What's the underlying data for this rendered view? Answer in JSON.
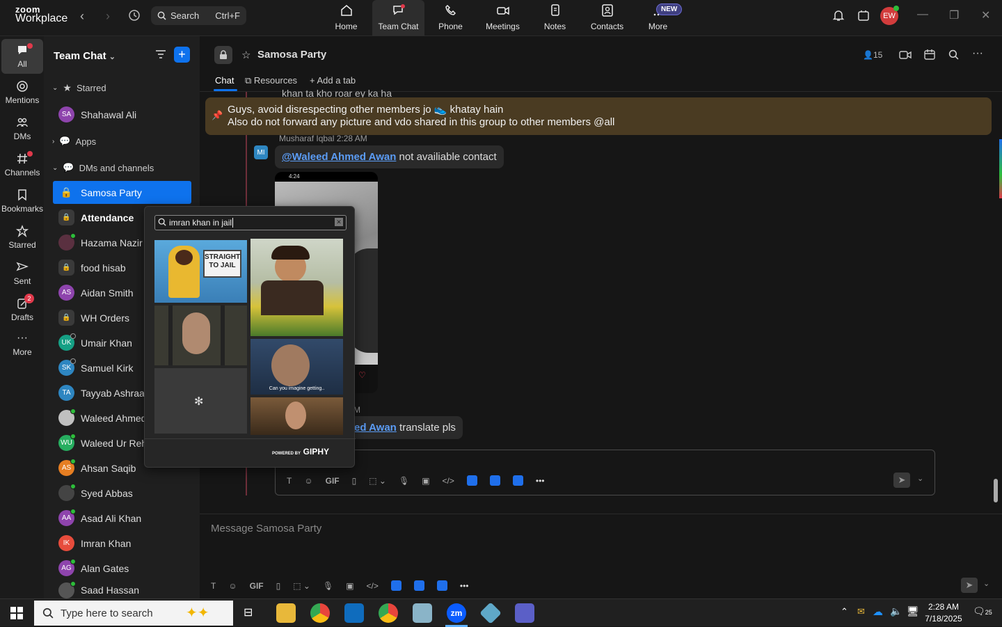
{
  "app": {
    "logo_line1": "zoom",
    "logo_line2": "Workplace"
  },
  "search": {
    "label": "Search",
    "shortcut": "Ctrl+F"
  },
  "topnav": [
    {
      "label": "Home",
      "icon": "home-icon"
    },
    {
      "label": "Team Chat",
      "icon": "chat-icon",
      "active": true
    },
    {
      "label": "Phone",
      "icon": "phone-icon"
    },
    {
      "label": "Meetings",
      "icon": "camera-icon"
    },
    {
      "label": "Notes",
      "icon": "notes-icon"
    },
    {
      "label": "Contacts",
      "icon": "contacts-icon"
    },
    {
      "label": "More",
      "icon": "more-icon"
    }
  ],
  "new_badge": "NEW",
  "user_initials": "EW",
  "rail": [
    {
      "label": "All"
    },
    {
      "label": "Mentions"
    },
    {
      "label": "DMs"
    },
    {
      "label": "Channels"
    },
    {
      "label": "Bookmarks"
    },
    {
      "label": "Starred"
    },
    {
      "label": "Sent"
    },
    {
      "label": "Drafts",
      "badge": "2"
    },
    {
      "label": "More"
    }
  ],
  "sidebar": {
    "title": "Team Chat",
    "starred_label": "Starred",
    "apps_label": "Apps",
    "dms_label": "DMs and channels",
    "starred_item": "Shahawal Ali",
    "items": [
      "Samosa Party",
      "Attendance",
      "Hazama Nazir",
      "food hisab",
      "Aidan Smith",
      "WH Orders",
      "Umair Khan",
      "Samuel Kirk",
      "Tayyab Ashraaf",
      "Waleed Ahmed",
      "Waleed Ur Rehm",
      "Ahsan Saqib",
      "Syed Abbas",
      "Asad Ali Khan",
      "Imran Khan",
      "Alan Gates",
      "Saad Hassan"
    ],
    "initials": {
      "SA": "SA",
      "AS": "AS",
      "UK": "UK",
      "SK": "SK",
      "TA": "TA",
      "WU": "WU",
      "AS2": "AS",
      "AA": "AA",
      "IK": "IK",
      "AG": "AG"
    }
  },
  "chat": {
    "title": "Samosa Party",
    "member_count": "15",
    "tabs": {
      "chat": "Chat",
      "resources": "Resources",
      "add": "Add a tab"
    },
    "partial_text": "khan ta kho roar ey ka ha",
    "pinned_line1": "Guys, avoid disrespecting other members jo 👟 khatay hain",
    "pinned_line2": "Also do not forward any picture and vdo shared in this group to other members @all",
    "sender": "Musharaf Iqbal",
    "time": "2:28 AM",
    "sender_initials": "MI",
    "msg1_mention": "@Waleed Ahmed Awan",
    "msg1_text": " not availiable contact",
    "msg2_mention": "ed Awan",
    "msg2_text": " translate pls",
    "time2_fragment": "M",
    "image_clock": "4:24"
  },
  "gif": {
    "query": "imran khan in jail",
    "sign_text": "STRAIGHT TO JAIL",
    "caption": "Can you imagine getting..",
    "powered": "POWERED BY",
    "brand": "GIPHY"
  },
  "composer": {
    "placeholder": "Message Samosa Party",
    "gif_label": "GIF"
  },
  "taskbar": {
    "search": "Type here to search",
    "time": "2:28 AM",
    "date": "7/18/2025",
    "notif": "25"
  }
}
